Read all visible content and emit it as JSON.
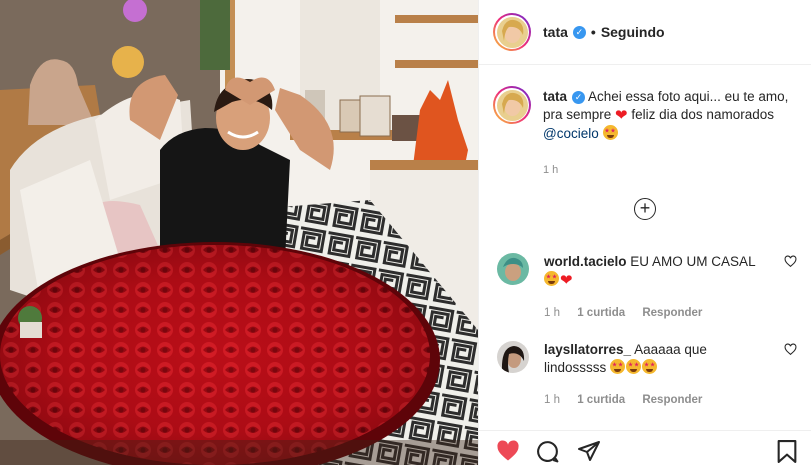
{
  "post": {
    "username": "tata",
    "follow_status": "Seguindo",
    "caption_text": "Achei essa foto aqui... eu te amo, pra sempre",
    "caption_text_2": "feliz dia dos namorados",
    "caption_mention": "@cocielo",
    "caption_time": "1 h"
  },
  "comments": [
    {
      "username": "world.tacielo",
      "text": "EU AMO UM CASAL",
      "time": "1 h",
      "likes": "1 curtida",
      "reply": "Responder"
    },
    {
      "username": "laysllatorres_",
      "text": "Aaaaaa que lindosssss",
      "time": "1 h",
      "likes": "1 curtida",
      "reply": "Responder"
    }
  ],
  "icons": {
    "verified": "verified-badge-icon",
    "like_active": "heart-filled-icon",
    "comment": "comment-bubble-icon",
    "share": "paper-plane-icon",
    "save": "bookmark-icon",
    "add_comment": "plus-circle-icon"
  },
  "colors": {
    "like_red": "#ed4956",
    "verified_blue": "#3897f0",
    "link_blue": "#00376b",
    "muted_text": "#8e8e8e"
  }
}
